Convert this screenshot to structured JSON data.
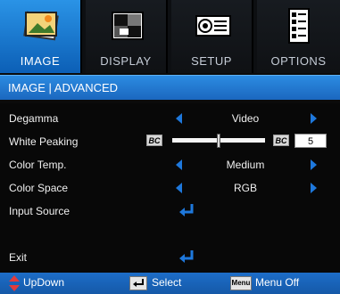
{
  "tabs": [
    {
      "label": "IMAGE",
      "icon": "picture-icon",
      "active": true
    },
    {
      "label": "DISPLAY",
      "icon": "display-icon",
      "active": false
    },
    {
      "label": "SETUP",
      "icon": "projector-icon",
      "active": false
    },
    {
      "label": "OPTIONS",
      "icon": "options-icon",
      "active": false
    }
  ],
  "breadcrumb": "IMAGE | ADVANCED",
  "menu": {
    "degamma": {
      "label": "Degamma",
      "value": "Video"
    },
    "white_peaking": {
      "label": "White Peaking",
      "bc_left": "BC",
      "bc_right": "BC",
      "value": "5",
      "level_fraction": 0.5
    },
    "color_temp": {
      "label": "Color Temp.",
      "value": "Medium"
    },
    "color_space": {
      "label": "Color Space",
      "value": "RGB"
    },
    "input_source": {
      "label": "Input Source"
    },
    "exit": {
      "label": "Exit"
    }
  },
  "footer": {
    "updown": "UpDown",
    "select": "Select",
    "menu_key": "Menu",
    "menu_off": "Menu Off"
  },
  "colors": {
    "accent": "#1e78dc",
    "active_tab": "#2a93e6"
  }
}
